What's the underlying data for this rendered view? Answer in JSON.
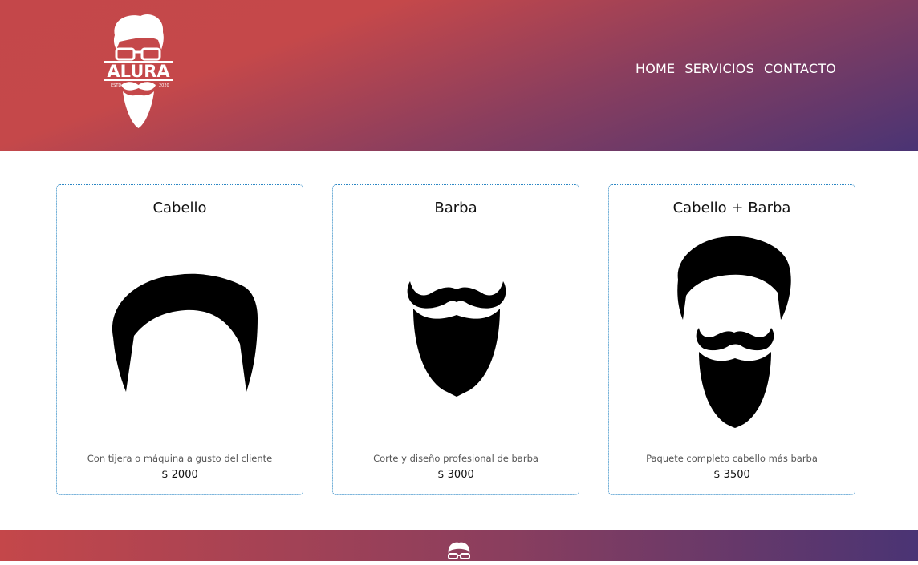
{
  "header": {
    "logo": {
      "name": "ALURA",
      "estd": "ESTD",
      "year": "2020"
    },
    "nav": [
      {
        "label": "HOME"
      },
      {
        "label": "SERVICIOS"
      },
      {
        "label": "CONTACTO"
      }
    ]
  },
  "services": [
    {
      "title": "Cabello",
      "description": "Con tijera o máquina a gusto del cliente",
      "price": "$ 2000"
    },
    {
      "title": "Barba",
      "description": "Corte y diseño profesional de barba",
      "price": "$ 3000"
    },
    {
      "title": "Cabello + Barba",
      "description": "Paquete completo cabello más barba",
      "price": "$ 3500"
    }
  ],
  "colors": {
    "header_gradient_start": "#c4474a",
    "header_gradient_end": "#4a3474",
    "card_border": "#2a86c4"
  }
}
